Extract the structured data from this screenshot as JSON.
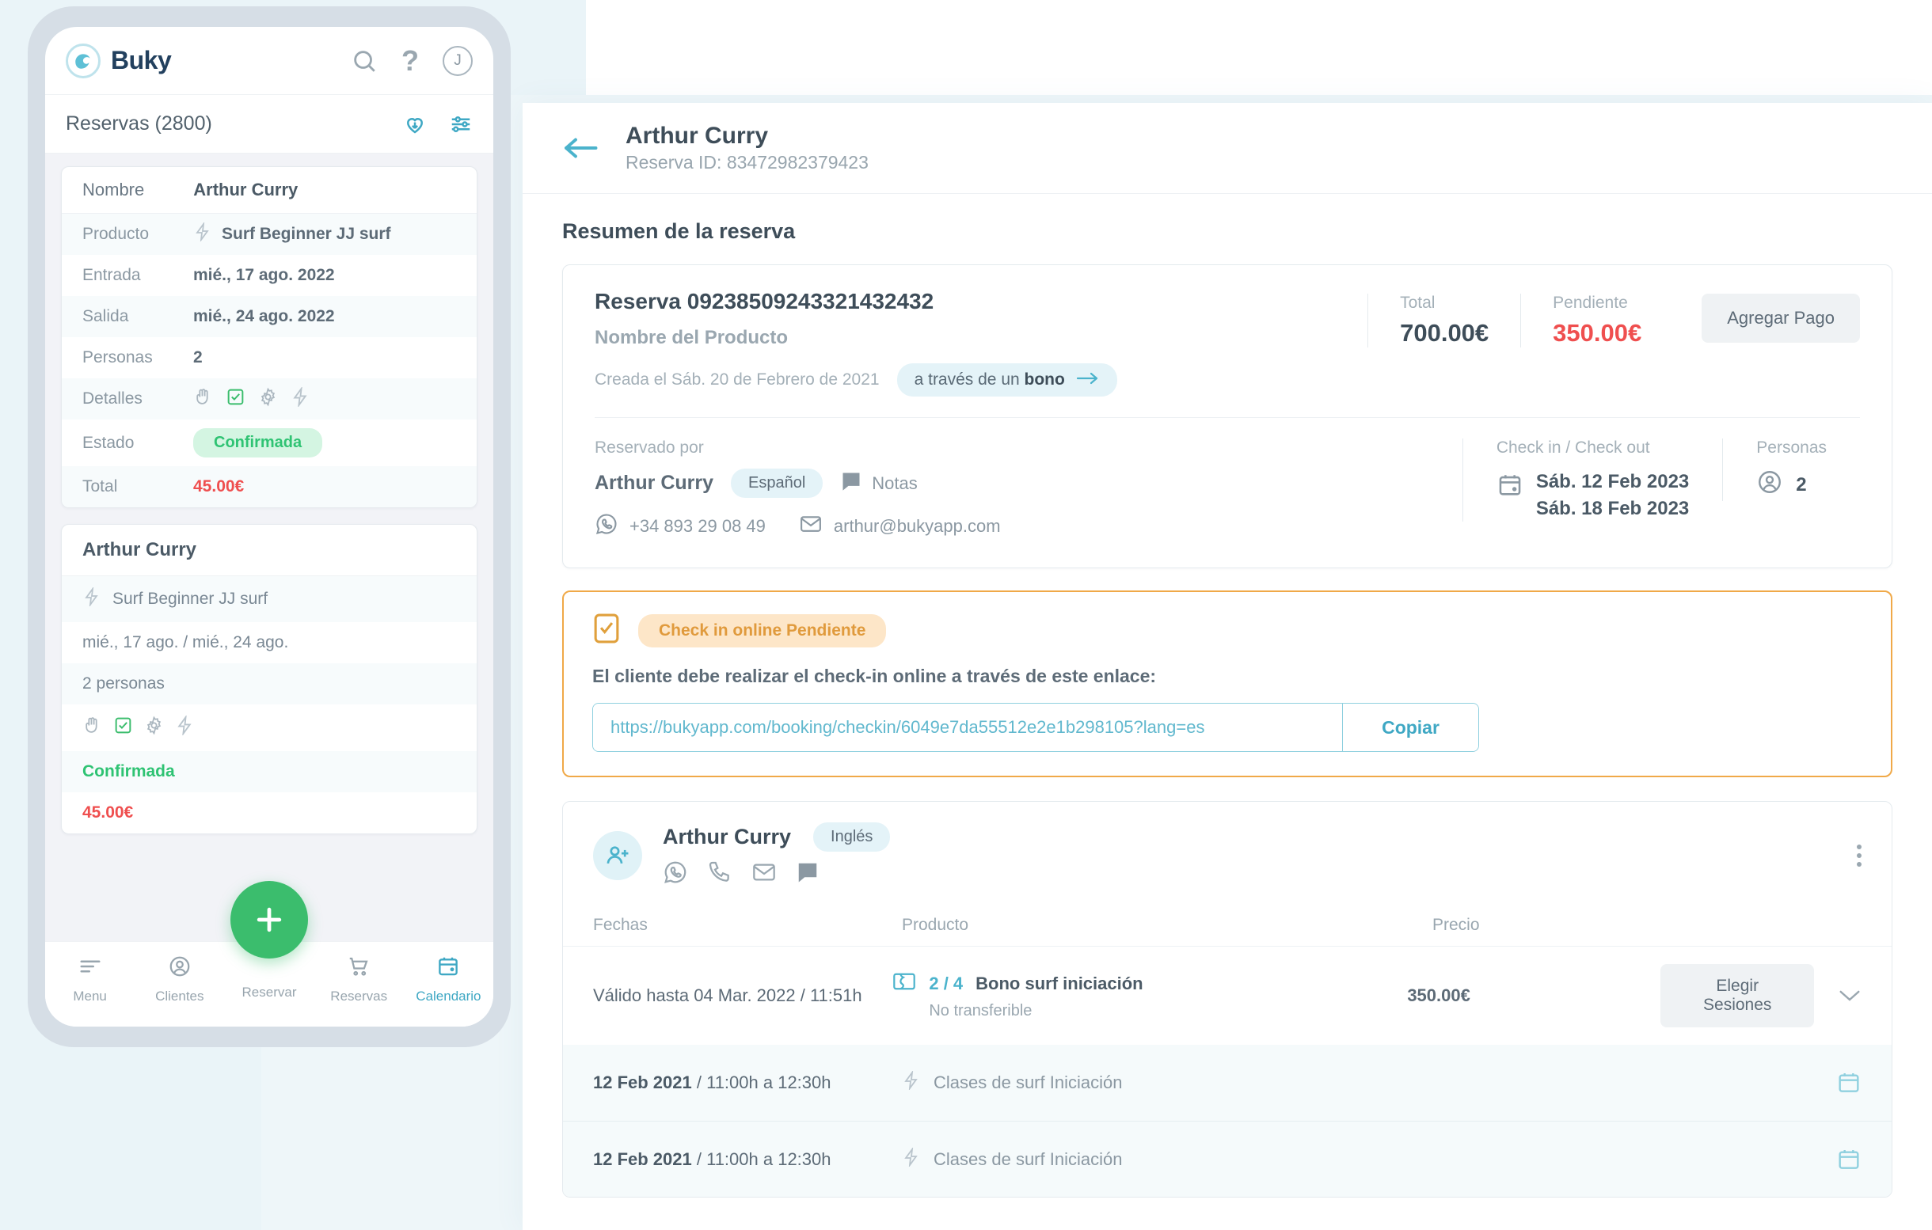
{
  "phone": {
    "brand": "Buky",
    "top_icons": [
      "search-icon",
      "help-icon",
      "user-avatar-j"
    ],
    "avatar_letter": "J",
    "list_title": "Reservas (2800)",
    "sub_icons": [
      "save-heart-icon",
      "filter-icon"
    ],
    "card1": {
      "head_key": "Nombre",
      "head_value": "Arthur Curry",
      "rows": [
        {
          "key": "Producto",
          "value": "Surf Beginner JJ surf",
          "icon": "bolt-icon"
        },
        {
          "key": "Entrada",
          "value": "mié., 17 ago. 2022"
        },
        {
          "key": "Salida",
          "value": "mié., 24 ago. 2022"
        },
        {
          "key": "Personas",
          "value": "2"
        },
        {
          "key": "Detalles",
          "value": "",
          "icons": [
            "hand-icon",
            "checkbox-icon",
            "gear-icon",
            "bolt-icon"
          ]
        },
        {
          "key": "Estado",
          "value": "Confirmada",
          "badge": true
        },
        {
          "key": "Total",
          "value": "45.00€",
          "price": true
        }
      ]
    },
    "card2": {
      "title": "Arthur Curry",
      "product": "Surf Beginner JJ surf",
      "dates": "mié., 17 ago. / mié., 24 ago.",
      "people": "2 personas",
      "icons": [
        "hand-icon",
        "checkbox-icon",
        "gear-icon",
        "bolt-icon"
      ],
      "status": "Confirmada",
      "total": "45.00€"
    },
    "fab": "add-icon",
    "nav": [
      {
        "label": "Menu",
        "icon": "menu-icon",
        "active": false
      },
      {
        "label": "Clientes",
        "icon": "user-icon",
        "active": false
      },
      {
        "label": "Reservar",
        "icon": "plus-icon",
        "active": false
      },
      {
        "label": "Reservas",
        "icon": "cart-icon",
        "active": false
      },
      {
        "label": "Calendario",
        "icon": "calendar-icon",
        "active": true
      }
    ]
  },
  "detail": {
    "back": "back-arrow-icon",
    "title": "Arthur Curry",
    "subtitle": "Reserva ID: 83472982379423",
    "section_title": "Resumen de la reserva",
    "summary": {
      "reserva_no": "Reserva 09238509243321432432",
      "product_name": "Nombre del Producto",
      "created": "Creada el Sáb. 20 de Febrero de 2021",
      "channel_prefix": "a través de un ",
      "channel_bold": "bono",
      "total_label": "Total",
      "total_value": "700.00€",
      "pending_label": "Pendiente",
      "pending_value": "350.00€",
      "add_payment": "Agregar Pago",
      "booked_by_label": "Reservado por",
      "booked_by_name": "Arthur Curry",
      "language": "Español",
      "notes": "Notas",
      "phone": "+34 893 29 08 49",
      "email": "arthur@bukyapp.com",
      "checkinout_label": "Check in / Check out",
      "checkin_date": "Sáb. 12 Feb 2023",
      "checkout_date": "Sáb. 18 Feb 2023",
      "people_label": "Personas",
      "people_value": "2"
    },
    "checkin_box": {
      "chip": "Check in online Pendiente",
      "text": "El cliente debe realizar el check-in online a través de este enlace:",
      "url": "https://bukyapp.com/booking/checkin/6049e7da55512e2e1b298105?lang=es",
      "copy_label": "Copiar"
    },
    "participant": {
      "name": "Arthur Curry",
      "language": "Inglés",
      "icons": [
        "whatsapp-icon",
        "phone-icon",
        "mail-icon",
        "chat-icon"
      ],
      "table_headers": {
        "dates": "Fechas",
        "product": "Producto",
        "price": "Precio"
      },
      "bono_row": {
        "dates": "Válido hasta 04 Mar. 2022 / 11:51h",
        "fraction": "2 / 4",
        "product": "Bono surf iniciación",
        "note": "No transferible",
        "price": "350.00€",
        "button": "Elegir Sesiones"
      },
      "sessions": [
        {
          "date": "12 Feb 2021",
          "time": " / 11:00h a 12:30h",
          "product": "Clases de surf Iniciación"
        },
        {
          "date": "12 Feb 2021",
          "time": " / 11:00h a 12:30h",
          "product": "Clases de surf Iniciación"
        }
      ]
    }
  },
  "colors": {
    "accent": "#4bb3cc",
    "green": "#2fc373",
    "red": "#ef4f4f",
    "orange": "#f0a948",
    "navy": "#22405e"
  }
}
